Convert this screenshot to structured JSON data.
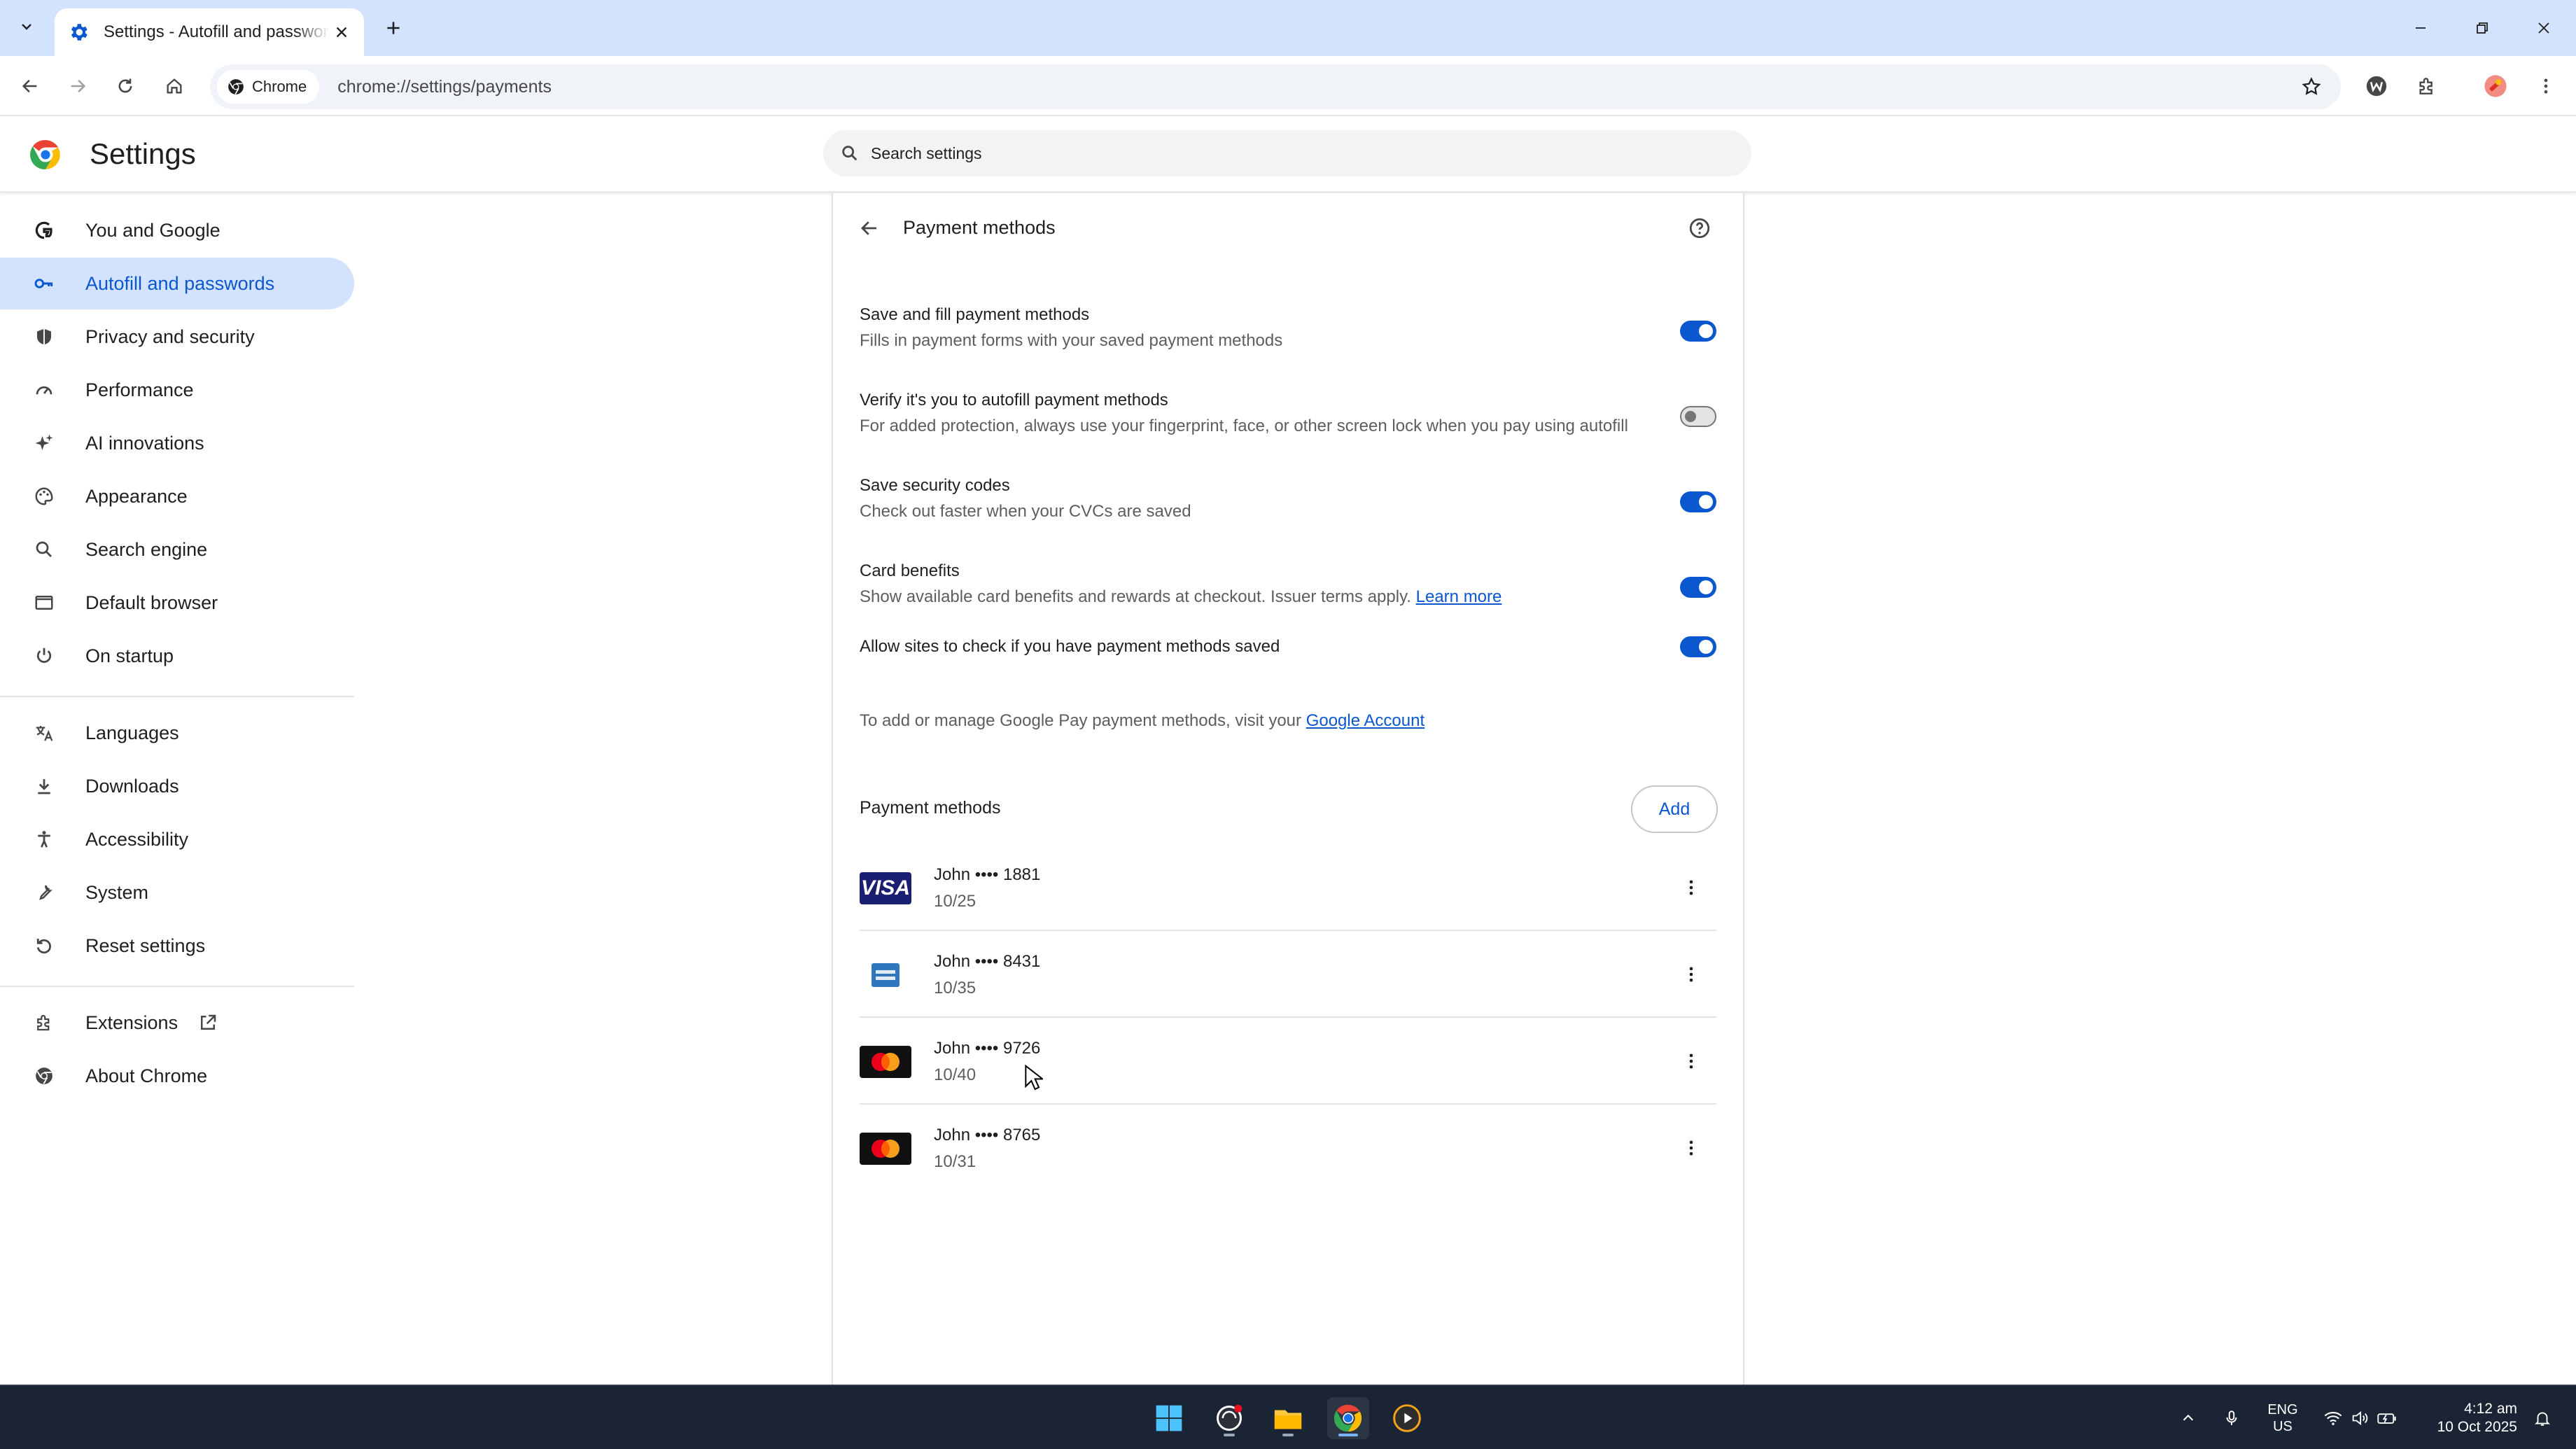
{
  "browser": {
    "tab_title": "Settings - Autofill and passwords",
    "chip_label": "Chrome",
    "url": "chrome://settings/payments"
  },
  "settings": {
    "title": "Settings",
    "search_placeholder": "Search settings"
  },
  "sidebar": {
    "items": [
      {
        "label": "You and Google",
        "icon": "google-g-icon"
      },
      {
        "label": "Autofill and passwords",
        "icon": "key-icon",
        "active": true
      },
      {
        "label": "Privacy and security",
        "icon": "shield-icon"
      },
      {
        "label": "Performance",
        "icon": "speedometer-icon"
      },
      {
        "label": "AI innovations",
        "icon": "sparkle-icon"
      },
      {
        "label": "Appearance",
        "icon": "palette-icon"
      },
      {
        "label": "Search engine",
        "icon": "search-icon"
      },
      {
        "label": "Default browser",
        "icon": "browser-window-icon"
      },
      {
        "label": "On startup",
        "icon": "power-icon"
      },
      {
        "label": "Languages",
        "icon": "translate-icon"
      },
      {
        "label": "Downloads",
        "icon": "download-icon"
      },
      {
        "label": "Accessibility",
        "icon": "accessibility-icon"
      },
      {
        "label": "System",
        "icon": "wrench-icon"
      },
      {
        "label": "Reset settings",
        "icon": "reset-icon"
      },
      {
        "label": "Extensions",
        "icon": "puzzle-icon"
      },
      {
        "label": "About Chrome",
        "icon": "chrome-icon"
      }
    ]
  },
  "page": {
    "title": "Payment methods",
    "settings_rows": [
      {
        "label": "Save and fill payment methods",
        "sub": "Fills in payment forms with your saved payment methods",
        "enabled": true
      },
      {
        "label": "Verify it's you to autofill payment methods",
        "sub": "For added protection, always use your fingerprint, face, or other screen lock when you pay using autofill",
        "enabled": false
      },
      {
        "label": "Save security codes",
        "sub": "Check out faster when your CVCs are saved",
        "enabled": true
      },
      {
        "label": "Card benefits",
        "sub": "Show available card benefits and rewards at checkout. Issuer terms apply.",
        "link": "Learn more",
        "enabled": true
      },
      {
        "label": "Allow sites to check if you have payment methods saved",
        "enabled": true
      }
    ],
    "google_note": "To add or manage Google Pay payment methods, visit your",
    "google_link": "Google Account",
    "payment_methods_heading": "Payment methods",
    "add_label": "Add",
    "cards": [
      {
        "name": "John •••• 1881",
        "expiry": "10/25",
        "brand": "visa"
      },
      {
        "name": "John •••• 8431",
        "expiry": "10/35",
        "brand": "amex"
      },
      {
        "name": "John •••• 9726",
        "expiry": "10/40",
        "brand": "mastercard"
      },
      {
        "name": "John •••• 8765",
        "expiry": "10/31",
        "brand": "mastercard"
      }
    ],
    "visa_text": "VISA"
  },
  "taskbar": {
    "lang_top": "ENG",
    "lang_bottom": "US",
    "time": "4:12 am",
    "date": "10 Oct 2025"
  },
  "colors": {
    "accent": "#0b57d0",
    "active_nav_bg": "#d3e3fd",
    "tabstrip_bg": "#d3e3fd",
    "taskbar_bg": "#1b2434"
  }
}
